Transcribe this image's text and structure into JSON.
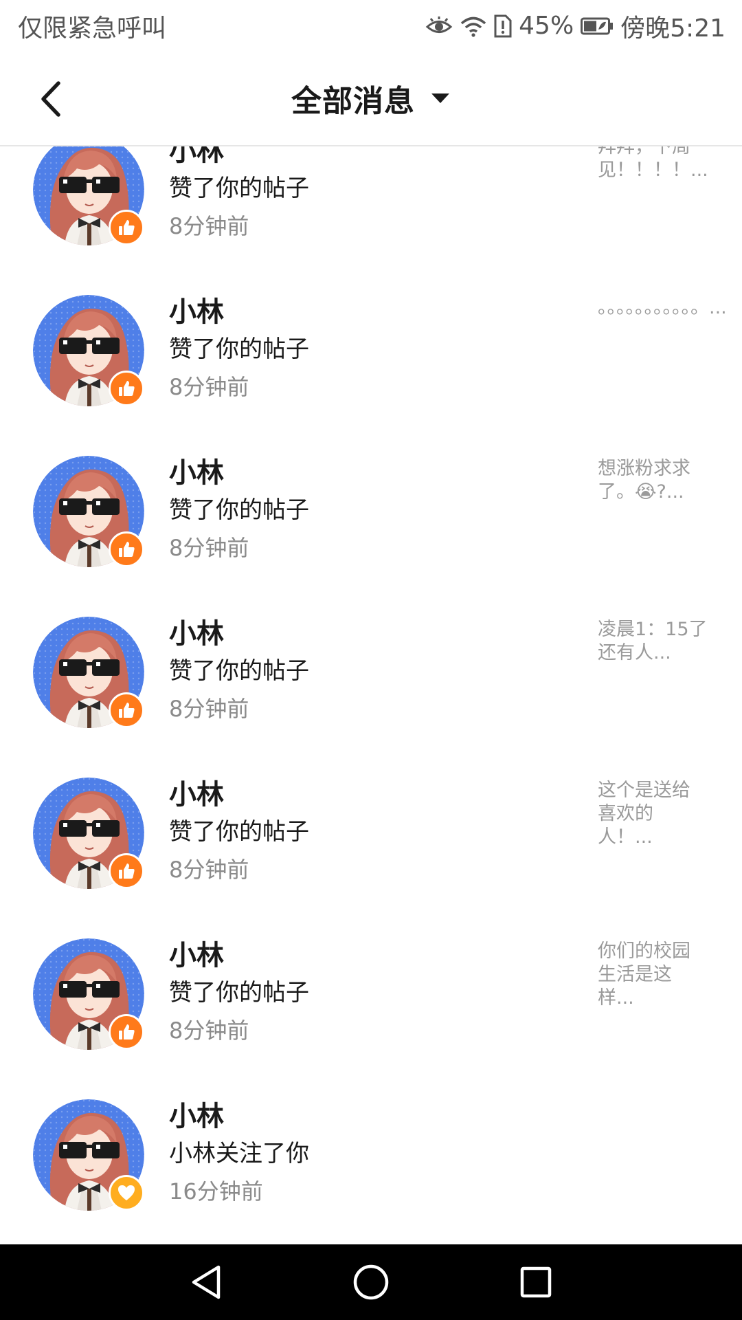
{
  "status_bar": {
    "carrier": "仅限紧急呼叫",
    "battery_percent": "45%",
    "time": "傍晚5:21",
    "icons": [
      "eye-comfort-icon",
      "wifi-icon",
      "sim-alert-icon",
      "battery-icon"
    ]
  },
  "header": {
    "title": "全部消息",
    "back_icon": "chevron-left-icon",
    "dropdown_icon": "caret-down-icon"
  },
  "messages": [
    {
      "name": "小林",
      "action": "赞了你的帖子",
      "time": "8分钟前",
      "preview": "拜拜，下周见！！！！...",
      "badge": "like"
    },
    {
      "name": "小林",
      "action": "赞了你的帖子",
      "time": "8分钟前",
      "preview": "。。。。。。。。。。。...",
      "badge": "like"
    },
    {
      "name": "小林",
      "action": "赞了你的帖子",
      "time": "8分钟前",
      "preview": "想涨粉求求了。😭?...",
      "badge": "like"
    },
    {
      "name": "小林",
      "action": "赞了你的帖子",
      "time": "8分钟前",
      "preview": "凌晨1：15了还有人...",
      "badge": "like"
    },
    {
      "name": "小林",
      "action": "赞了你的帖子",
      "time": "8分钟前",
      "preview": "这个是送给喜欢的人！...",
      "badge": "like"
    },
    {
      "name": "小林",
      "action": "赞了你的帖子",
      "time": "8分钟前",
      "preview": "你们的校园生活是这样...",
      "badge": "like"
    },
    {
      "name": "小林",
      "action": "小林关注了你",
      "time": "16分钟前",
      "preview": "",
      "badge": "follow"
    }
  ],
  "nav_bar": {
    "buttons": [
      "back-triangle-icon",
      "home-circle-icon",
      "recents-square-icon"
    ]
  },
  "colors": {
    "like_badge": "#ff7a1a",
    "follow_badge": "#ffad1f",
    "avatar_bg": "#4f7fe8",
    "nav_bar": "#000000"
  }
}
